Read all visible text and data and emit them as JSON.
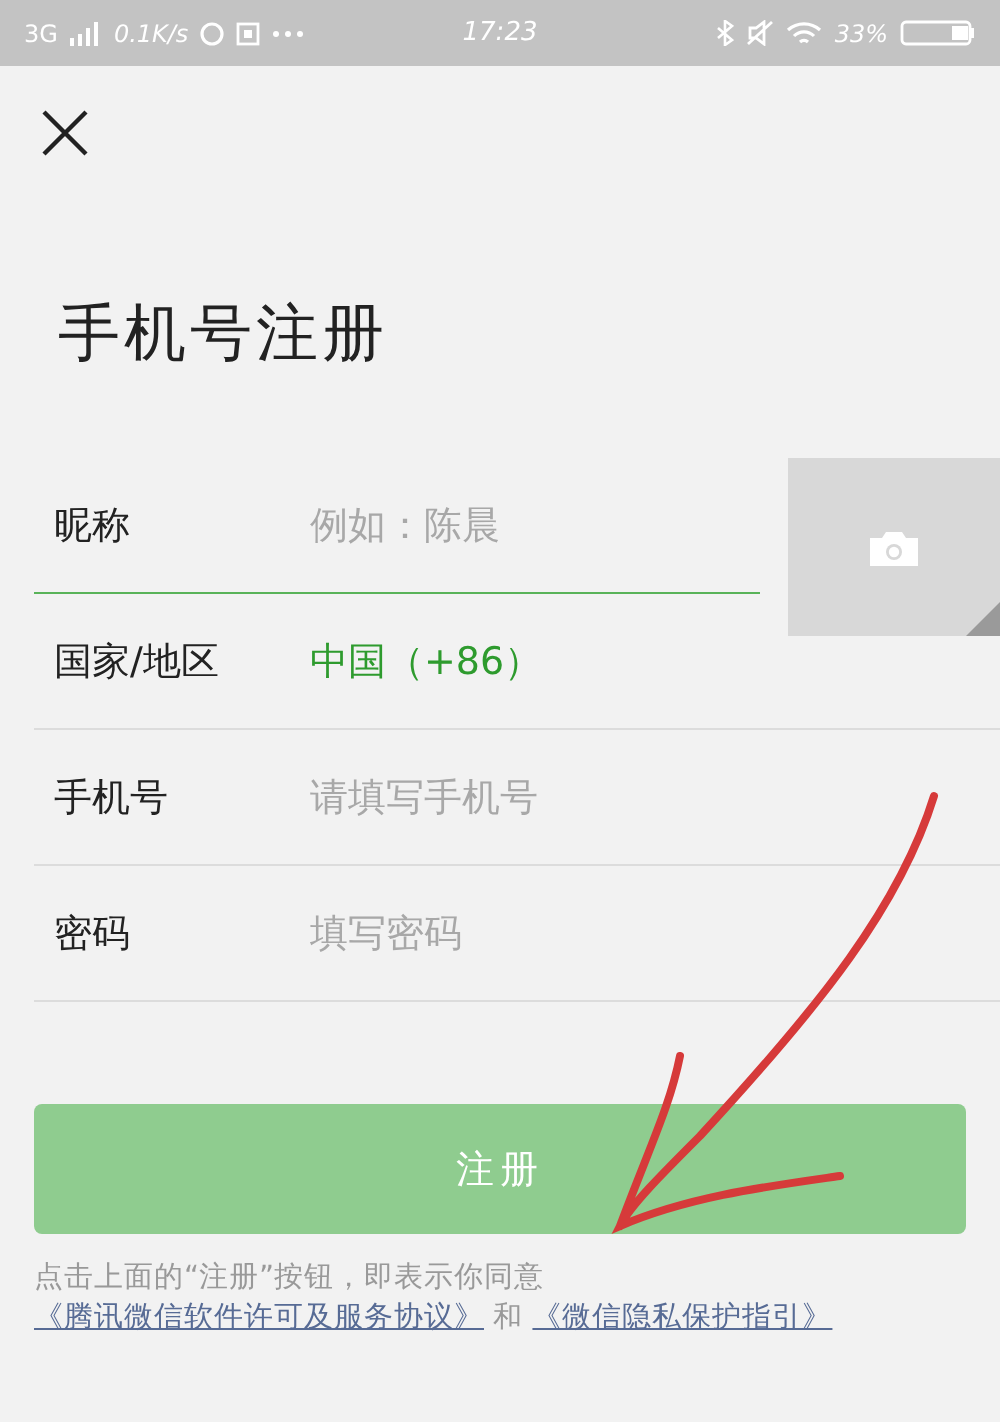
{
  "status_bar": {
    "network": "3G",
    "speed": "0.1K/s",
    "time": "17:23",
    "battery": "33%"
  },
  "title": "手机号注册",
  "fields": [
    {
      "kind": "input",
      "label": "昵称",
      "placeholder": "例如：陈晨",
      "focused": true
    },
    {
      "kind": "select",
      "label": "国家/地区",
      "value": "中国（+86）",
      "focused": false
    },
    {
      "kind": "input",
      "label": "手机号",
      "placeholder": "请填写手机号",
      "focused": false
    },
    {
      "kind": "input",
      "label": "密码",
      "placeholder": "填写密码",
      "focused": false
    }
  ],
  "register_button": {
    "label": "注册",
    "disabled": true
  },
  "agreement": {
    "text": "点击上面的“注册”按钮，即表示你同意",
    "link_1": "《腾讯微信软件许可及服务协议》",
    "joiner": "和",
    "link_2": "《微信隐私保护指引》"
  }
}
